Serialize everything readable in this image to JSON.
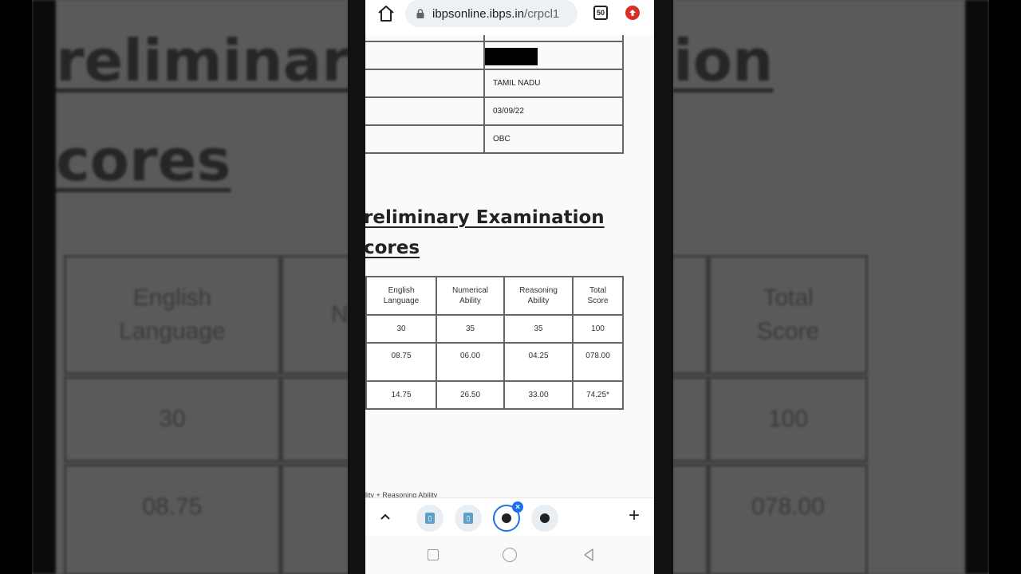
{
  "browser": {
    "url_host": "ibpsonline.ibps.in",
    "url_path": "/crpcl1",
    "tab_count": "50",
    "accent_color": "#1a73e8",
    "update_color": "#d93025"
  },
  "candidate_details": {
    "rows": [
      {
        "label": "",
        "value": ""
      },
      {
        "label": "",
        "value": "[redacted]"
      },
      {
        "label": "",
        "value": "TAMIL NADU"
      },
      {
        "label": "",
        "value": "03/09/22"
      },
      {
        "label": "",
        "value": "OBC"
      }
    ]
  },
  "section": {
    "title_line1": "reliminary Examination",
    "title_line2": "cores"
  },
  "scores_table": {
    "headers": [
      {
        "line1": "English",
        "line2": "Language"
      },
      {
        "line1": "Numerical",
        "line2": "Ability"
      },
      {
        "line1": "Reasoning",
        "line2": "Ability"
      },
      {
        "line1": "Total",
        "line2": "Score"
      }
    ],
    "rows": [
      [
        "30",
        "35",
        "35",
        "100"
      ],
      [
        "08.75",
        "06.00",
        "04.25",
        "078.00"
      ],
      [
        "14.75",
        "26.50",
        "33.00",
        "74.25*"
      ]
    ]
  },
  "footnote": "ility + Reasoning Ability",
  "background_zoom": {
    "title_line1": "reliminary",
    "title_line1_right": "ion",
    "title_line2": "cores",
    "header_left": {
      "line1": "English",
      "line2": "Language"
    },
    "header_partial": "N",
    "header_right": {
      "line1": "Total",
      "line2": "Score"
    },
    "row1_left": "30",
    "row1_right": "100",
    "row2_left": "08.75",
    "row2_right": "078.00"
  }
}
